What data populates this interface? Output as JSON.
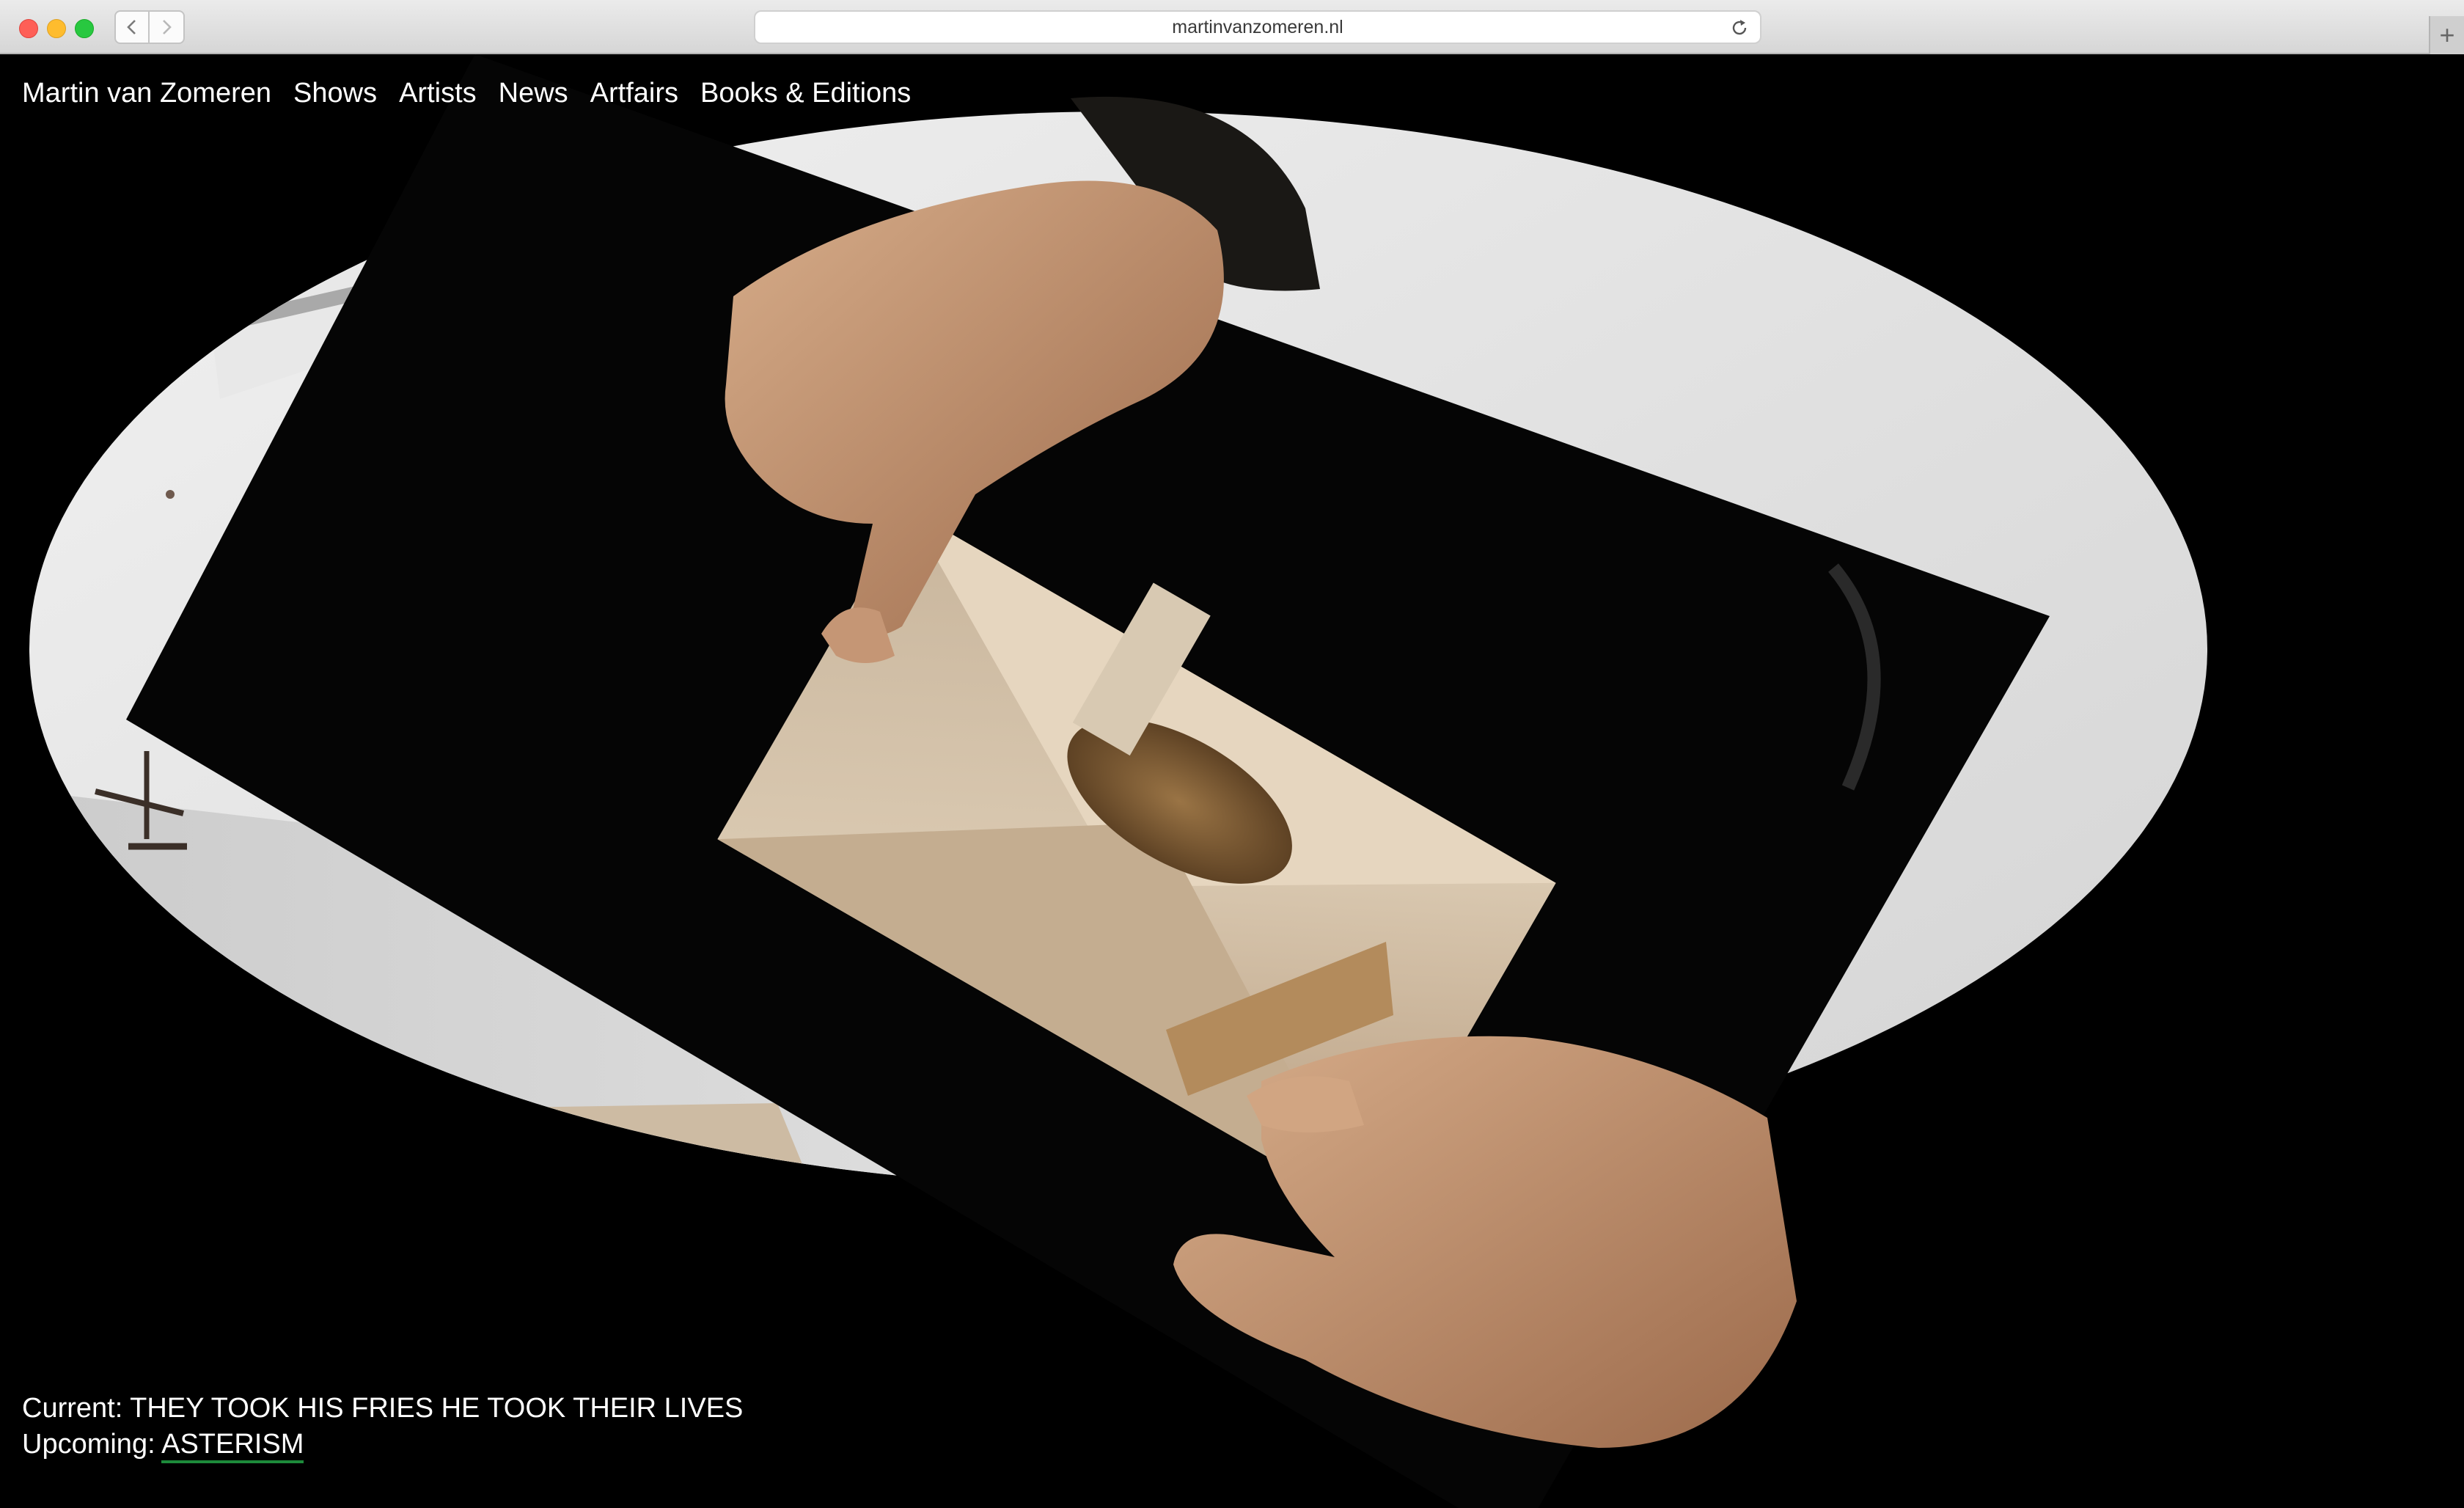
{
  "browser": {
    "url": "martinvanzomeren.nl",
    "icons": [
      "back-arrow-icon",
      "forward-arrow-icon",
      "reload-icon",
      "plus-icon"
    ]
  },
  "site": {
    "brand": "Martin van Zomeren",
    "nav": [
      {
        "label": "Shows"
      },
      {
        "label": "Artists"
      },
      {
        "label": "News"
      },
      {
        "label": "Artfairs"
      },
      {
        "label": "Books & Editions"
      }
    ]
  },
  "status": {
    "current_label": "Current:",
    "current_title": "THEY TOOK HIS FRIES HE TOOK THEIR LIVES",
    "upcoming_label": "Upcoming:",
    "upcoming_title": "ASTERISM"
  },
  "colors": {
    "background": "#000000",
    "text": "#ffffff",
    "link_underline": "#1d8a3b"
  }
}
